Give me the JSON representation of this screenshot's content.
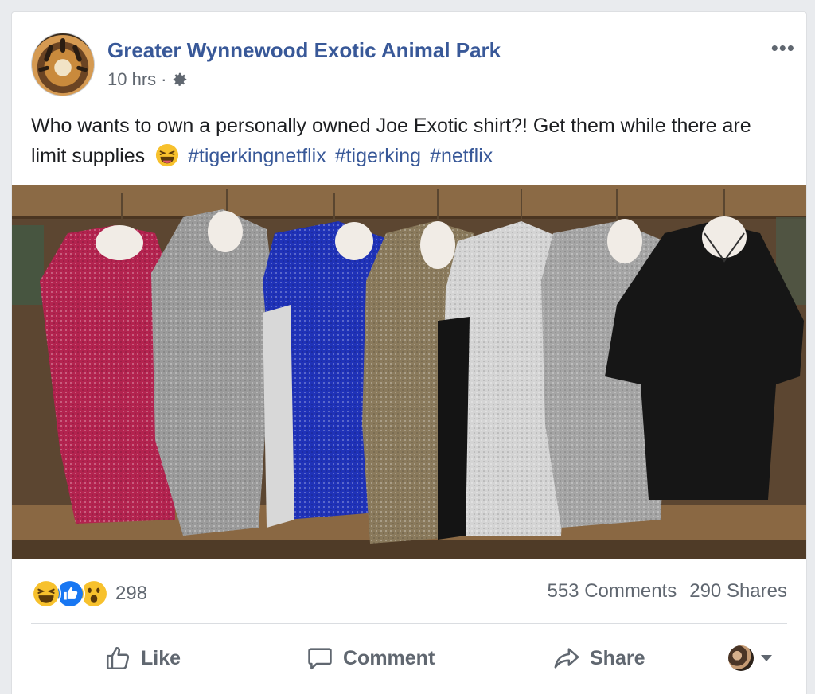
{
  "post": {
    "page_name": "Greater Wynnewood Exotic Animal Park",
    "time": "10 hrs",
    "separator": "·",
    "privacy_icon": "gear-icon",
    "more_icon": "more-options-icon",
    "more_label": "•••",
    "text": "Who wants to own a personally owned Joe Exotic shirt?! Get them while there are limit supplies",
    "emoji": "grinning-squinting-face-icon",
    "hashtags": [
      "#tigerkingnetflix",
      "#tigerking",
      "#netflix"
    ]
  },
  "photo": {
    "description_icon": "shirts-photo",
    "shirt_colors": [
      "#b3234f",
      "#9b9b9b",
      "#1f32b8",
      "#8a7a5c",
      "#d4d4d4",
      "#a5a5a5",
      "#161616"
    ]
  },
  "stats": {
    "reactions": [
      "haha-reaction-icon",
      "like-reaction-icon",
      "wow-reaction-icon"
    ],
    "reaction_count": "298",
    "comments": "553 Comments",
    "shares": "290 Shares"
  },
  "actions": {
    "like": "Like",
    "comment": "Comment",
    "share": "Share"
  },
  "colors": {
    "link_blue": "#385898",
    "text_gray": "#606770",
    "like_blue": "#1877f2",
    "emoji_yellow": "#f7c12d"
  }
}
